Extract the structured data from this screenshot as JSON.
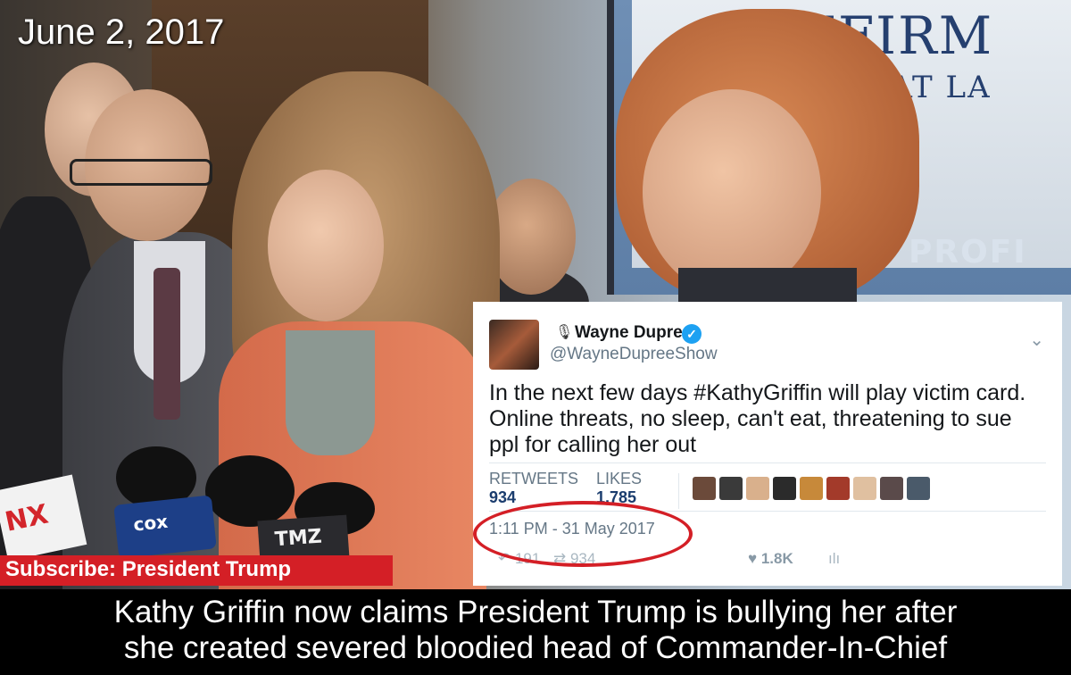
{
  "overlay": {
    "date": "June 2, 2017",
    "subscribe": "Subscribe: President Trump"
  },
  "banner": {
    "line1": "OMFIRM",
    "line2": "EYS AT LA",
    "line3": "PROFI"
  },
  "mic_flags": {
    "flag1": "NX",
    "flag2": "cox",
    "flag3": "TMZ"
  },
  "tweet": {
    "display_name": "Wayne Dupree",
    "handle": "@WayneDupreeShow",
    "text": "In the next few days #KathyGriffin will play victim card. Online threats, no sleep, can't eat, threatening to sue ppl for calling her out",
    "retweets_label": "RETWEETS",
    "retweets_value": "934",
    "likes_label": "LIKES",
    "likes_value": "1,785",
    "timestamp": "1:11 PM - 31 May 2017",
    "reply_count": "191",
    "retweet_count": "934",
    "like_count": "1.8K",
    "avatar_colors": [
      "#6b4a3a",
      "#3a3a3a",
      "#d9b08c",
      "#2b2b2b",
      "#c7893a",
      "#a33a2a",
      "#e0c0a0",
      "#5a4a4a",
      "#4a5a6a"
    ]
  },
  "caption": {
    "line1": "Kathy Griffin now claims President Trump is bullying her after",
    "line2": "she created severed bloodied head of Commander-In-Chief"
  },
  "colors": {
    "accent_red": "#d41f26",
    "twitter_blue": "#1da1f2"
  }
}
